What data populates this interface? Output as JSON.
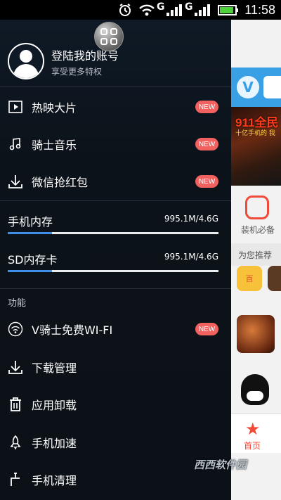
{
  "status_bar": {
    "clock": "11:58",
    "icons": [
      "alarm-icon",
      "wifi-icon",
      "signal-g-1-icon",
      "signal-g-2-icon",
      "battery-icon"
    ],
    "network_label_1": "G",
    "network_label_2": "G",
    "battery_level": 0.9
  },
  "drawer": {
    "profile": {
      "title": "登陆我的账号",
      "subtitle": "享受更多特权"
    },
    "menu_top": [
      {
        "label": "热映大片",
        "icon": "play-icon",
        "badge": "NEW"
      },
      {
        "label": "骑士音乐",
        "icon": "music-note-icon",
        "badge": "NEW"
      },
      {
        "label": "微信抢红包",
        "icon": "download-icon",
        "badge": "NEW"
      }
    ],
    "storage": [
      {
        "label": "手机内存",
        "value": "995.1M/4.6G",
        "used_fraction": 0.21
      },
      {
        "label": "SD内存卡",
        "value": "995.1M/4.6G",
        "used_fraction": 0.21
      }
    ],
    "section_title": "功能",
    "menu_features": [
      {
        "label": "V骑士免费WI-FI",
        "icon": "wifi-icon",
        "badge": "NEW"
      },
      {
        "label": "下载管理",
        "icon": "download-icon",
        "badge": ""
      },
      {
        "label": "应用卸载",
        "icon": "trash-icon",
        "badge": ""
      },
      {
        "label": "手机加速",
        "icon": "rocket-icon",
        "badge": ""
      },
      {
        "label": "手机清理",
        "icon": "broom-icon",
        "badge": ""
      }
    ]
  },
  "background_app": {
    "banner_title": "911全民",
    "banner_subtitle": "十亿手机的 我",
    "bag_label": "装机必备",
    "recommend_label": "为您推荐",
    "app1_label": "百",
    "home_label": "首页"
  },
  "watermark": "西西软件园"
}
